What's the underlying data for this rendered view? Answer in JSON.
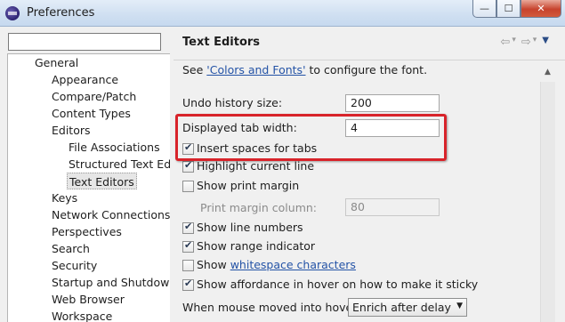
{
  "window": {
    "title": "Preferences",
    "btn_min": "—",
    "btn_max": "☐",
    "btn_close": "✕"
  },
  "filter": {
    "value": ""
  },
  "tree": {
    "items": [
      "General",
      "Appearance",
      "Compare/Patch",
      "Content Types",
      "Editors",
      "File Associations",
      "Structured Text Ed",
      "Text Editors",
      "Keys",
      "Network Connections",
      "Perspectives",
      "Search",
      "Security",
      "Startup and Shutdowr",
      "Web Browser",
      "Workspace"
    ],
    "selected": "Text Editors"
  },
  "header": {
    "title": "Text Editors",
    "back_icon": "⇦",
    "back_menu": "▾",
    "forward_icon": "⇨",
    "forward_menu": "▾",
    "menu_icon": "▼"
  },
  "content": {
    "see_prefix": "See ",
    "see_link": "'Colors and Fonts'",
    "see_suffix": " to configure the font.",
    "undo_label": "Undo history size:",
    "undo_value": "200",
    "tab_label": "Displayed tab width:",
    "tab_value": "4",
    "insert_spaces": "Insert spaces for tabs",
    "highlight_line": "Highlight current line",
    "show_margin": "Show print margin",
    "margin_col_label": "Print margin column:",
    "margin_col_value": "80",
    "show_line_numbers": "Show line numbers",
    "show_range": "Show range indicator",
    "show_ws_prefix": "Show ",
    "show_ws_link": "whitespace characters",
    "show_affordance": "Show affordance in hover on how to make it sticky",
    "mouse_label": "When mouse moved into hover:",
    "mouse_value": "Enrich after delay"
  }
}
